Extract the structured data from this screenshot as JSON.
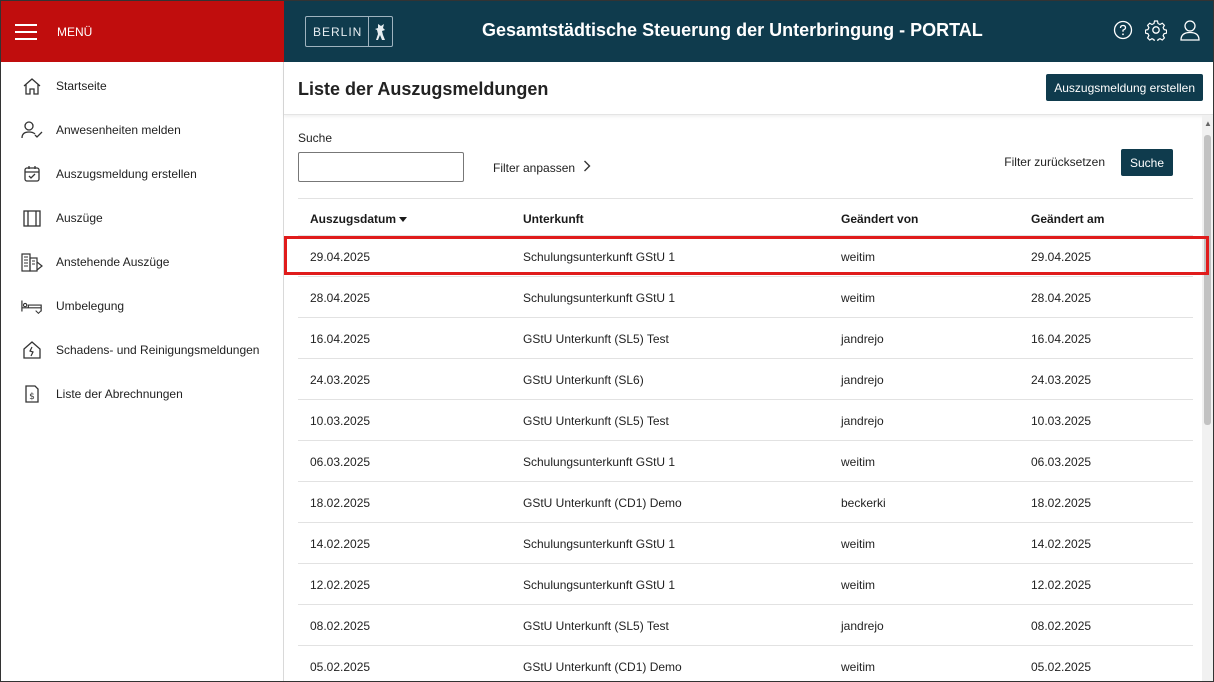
{
  "menu": {
    "label": "MENÜ"
  },
  "header": {
    "logo_text": "BERLIN",
    "title": "Gesamtstädtische Steuerung der Unterbringung - PORTAL",
    "icons": [
      "help-icon",
      "gear-icon",
      "user-icon"
    ]
  },
  "sidebar": {
    "items": [
      {
        "label": "Startseite",
        "icon": "home-icon"
      },
      {
        "label": "Anwesenheiten melden",
        "icon": "user-check-icon"
      },
      {
        "label": "Auszugsmeldung erstellen",
        "icon": "calendar-check-icon"
      },
      {
        "label": "Auszüge",
        "icon": "door-icon"
      },
      {
        "label": "Anstehende Auszüge",
        "icon": "building-icon"
      },
      {
        "label": "Umbelegung",
        "icon": "bed-icon"
      },
      {
        "label": "Schadens- und Reinigungsmeldungen",
        "icon": "house-damage-icon"
      },
      {
        "label": "Liste der Abrechnungen",
        "icon": "invoice-icon"
      }
    ]
  },
  "page": {
    "title": "Liste der Auszugsmeldungen",
    "create_button": "Auszugsmeldung erstellen",
    "search_label": "Suche",
    "search_value": "",
    "filter_link": "Filter anpassen",
    "reset_link": "Filter zurücksetzen",
    "search_button": "Suche"
  },
  "table": {
    "columns": [
      "Auszugsdatum",
      "Unterkunft",
      "Geändert von",
      "Geändert am"
    ],
    "rows": [
      [
        "29.04.2025",
        "Schulungsunterkunft GStU 1",
        "weitim",
        "29.04.2025"
      ],
      [
        "28.04.2025",
        "Schulungsunterkunft GStU 1",
        "weitim",
        "28.04.2025"
      ],
      [
        "16.04.2025",
        "GStU Unterkunft (SL5) Test",
        "jandrejo",
        "16.04.2025"
      ],
      [
        "24.03.2025",
        "GStU Unterkunft (SL6)",
        "jandrejo",
        "24.03.2025"
      ],
      [
        "10.03.2025",
        "GStU Unterkunft (SL5) Test",
        "jandrejo",
        "10.03.2025"
      ],
      [
        "06.03.2025",
        "Schulungsunterkunft GStU 1",
        "weitim",
        "06.03.2025"
      ],
      [
        "18.02.2025",
        "GStU Unterkunft (CD1) Demo",
        "beckerki",
        "18.02.2025"
      ],
      [
        "14.02.2025",
        "Schulungsunterkunft GStU 1",
        "weitim",
        "14.02.2025"
      ],
      [
        "12.02.2025",
        "Schulungsunterkunft GStU 1",
        "weitim",
        "12.02.2025"
      ],
      [
        "08.02.2025",
        "GStU Unterkunft (SL5) Test",
        "jandrejo",
        "08.02.2025"
      ],
      [
        "05.02.2025",
        "GStU Unterkunft (CD1) Demo",
        "weitim",
        "05.02.2025"
      ]
    ]
  },
  "colors": {
    "brand_red": "#c00d0d",
    "header_navy": "#0f3b4d",
    "highlight": "#e01b1b"
  }
}
